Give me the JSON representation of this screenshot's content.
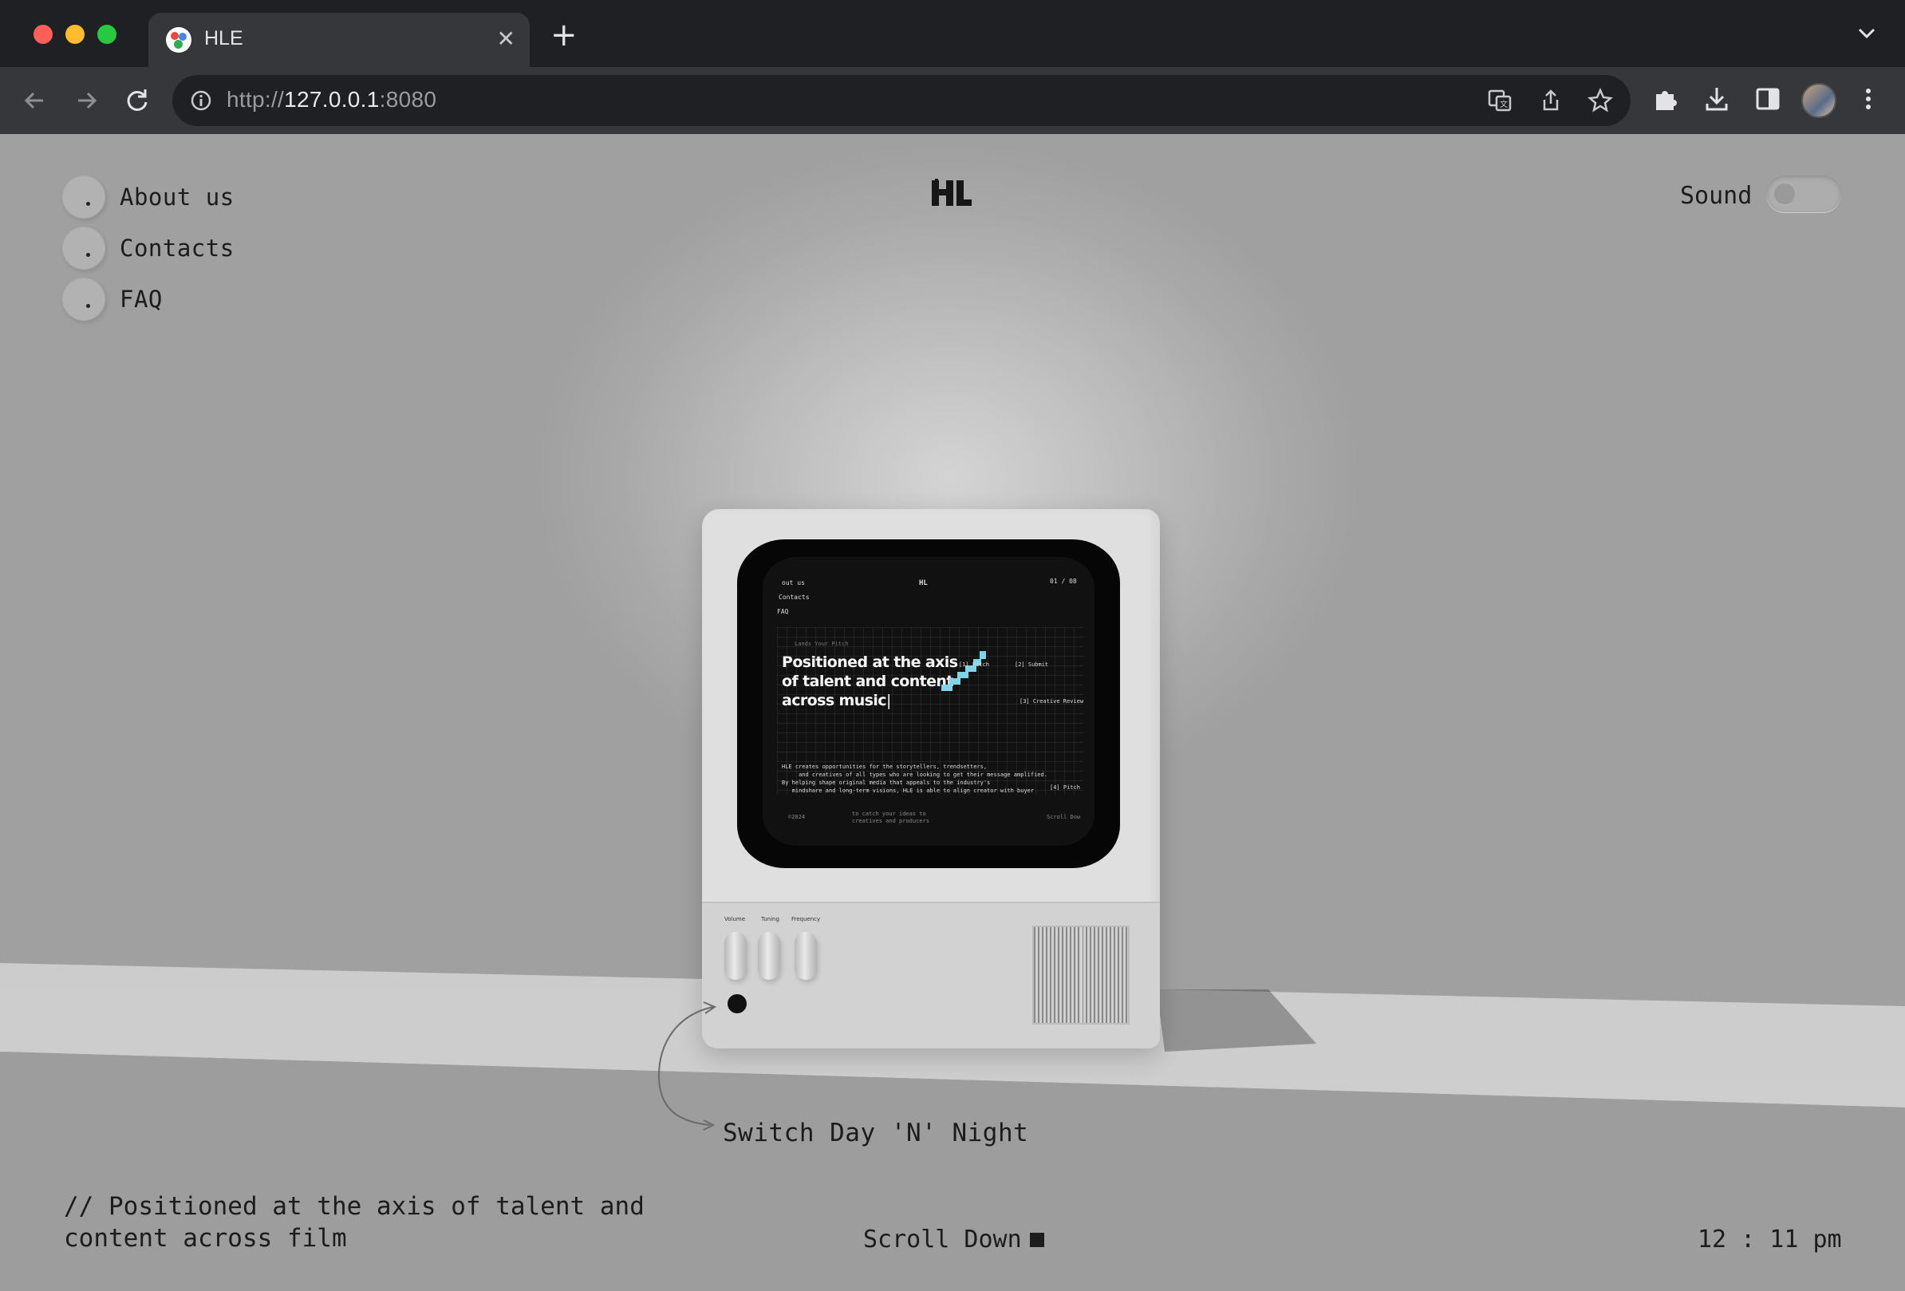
{
  "browser": {
    "tab_title": "HLE",
    "url_scheme": "http://",
    "url_host": "127.0.0.1",
    "url_port": ":8080"
  },
  "nav": {
    "items": [
      {
        "label": "About us"
      },
      {
        "label": "Contacts"
      },
      {
        "label": "FAQ"
      }
    ]
  },
  "logo": {
    "text": "HL"
  },
  "sound": {
    "label": "Sound",
    "enabled": false
  },
  "tv_screen": {
    "menu": [
      "out us",
      "Contacts",
      "FAQ"
    ],
    "logo": "HL",
    "counter": "01 / 08",
    "kicker": "Lands Your Pitch",
    "headline_1": "Positioned at the axis",
    "headline_2": "of talent and content",
    "headline_3": "across music",
    "steps": [
      "[1] Pitch",
      "[2] Submit",
      "[3] Creative Review",
      "[4] Pitch"
    ],
    "paragraph": "HLE creates opportunities for the storytellers, trendsetters,\n     and creatives of all types who are looking to get their message amplified.\nBy helping shape original media that appeals to the industry's\n   mindshare and long-term visions, HLE is able to align creator with buyer",
    "footer_left": "©2024",
    "footer_mid": "to catch your ideas to\ncreatives and producers",
    "footer_right": "Scroll Dow",
    "knobs": [
      "Volume",
      "Tuning",
      "Frequency"
    ]
  },
  "switch_label": "Switch Day 'N' Night",
  "tagline": "// Positioned at the axis of talent and content across film",
  "scroll_label": "Scroll Down",
  "clock": "12 : 11 pm"
}
